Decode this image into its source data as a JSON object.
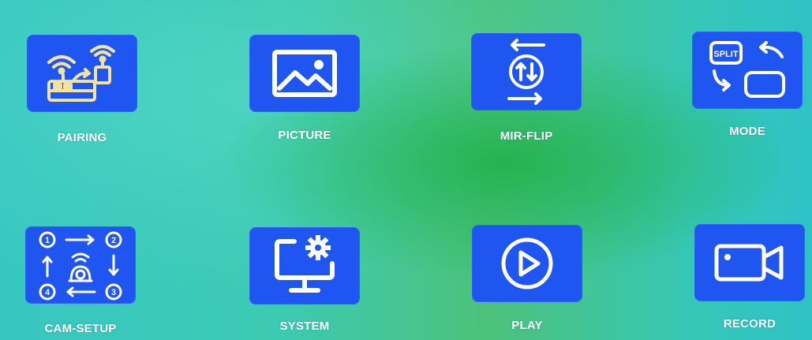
{
  "menu": {
    "items": [
      {
        "label": "PAIRING",
        "icon": "pairing-icon"
      },
      {
        "label": "PICTURE",
        "icon": "picture-icon"
      },
      {
        "label": "MIR-FLIP",
        "icon": "mirror-flip-icon"
      },
      {
        "label": "MODE",
        "icon": "mode-icon",
        "badge": "SPLIT"
      },
      {
        "label": "CAM-SETUP",
        "icon": "camera-setup-icon",
        "steps": [
          "1",
          "2",
          "3",
          "4"
        ]
      },
      {
        "label": "SYSTEM",
        "icon": "system-settings-icon"
      },
      {
        "label": "PLAY",
        "icon": "play-icon"
      },
      {
        "label": "RECORD",
        "icon": "record-camera-icon"
      }
    ]
  },
  "colors": {
    "tile": "#1f55f0",
    "icon_stroke": "#ffffff",
    "label": "#ffffff",
    "pairing_icon_fill": "#f3e3a3"
  }
}
